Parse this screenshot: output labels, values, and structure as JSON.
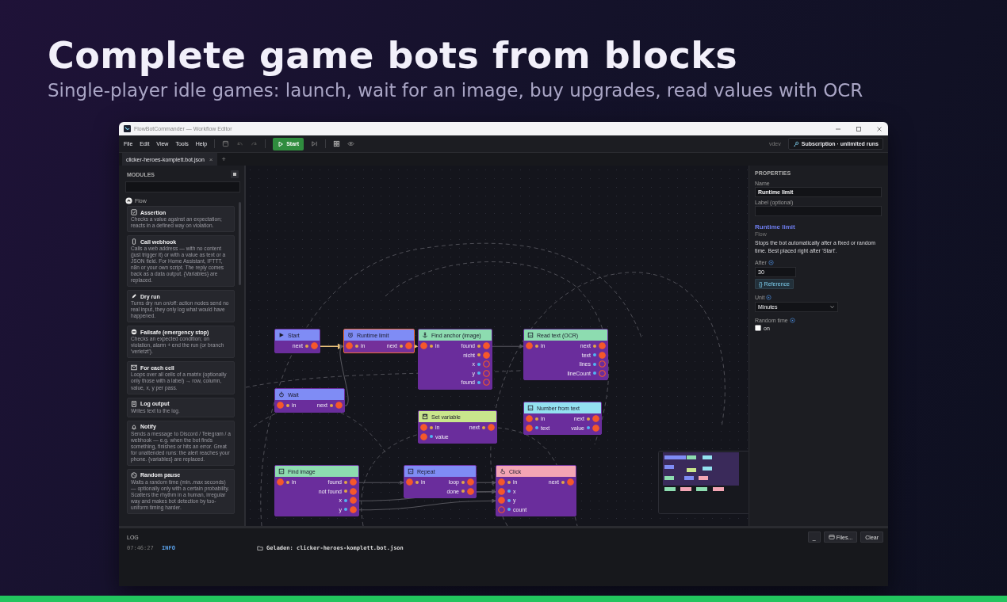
{
  "hero": {
    "title": "Complete game bots from blocks",
    "subtitle": "Single-player idle games: launch, wait for an image, buy upgrades, read values with OCR"
  },
  "window": {
    "title": "FlowBotCommander — Workflow Editor"
  },
  "menu": [
    "File",
    "Edit",
    "View",
    "Tools",
    "Help"
  ],
  "toolbar": {
    "start_label": "Start",
    "version": "vdev",
    "subscription": "Subscription · unlimited runs"
  },
  "tabs": [
    {
      "label": "clicker-heroes-komplett.bot.json",
      "selected": true,
      "close": "×"
    }
  ],
  "new_tab": "+",
  "sidebar": {
    "title": "MODULES",
    "section": {
      "label": "Flow",
      "expanded": true
    },
    "modules": [
      {
        "title": "Assertion",
        "description": "Checks a value against an expectation; reacts in a defined way on violation."
      },
      {
        "title": "Call webhook",
        "description": "Calls a web address — with no content (just trigger it) or with a value as text or a JSON field. For Home Assistant, IFTTT, n8n or your own script. The reply comes back as a data output. {Variables} are replaced."
      },
      {
        "title": "Dry run",
        "description": "Turns dry run on/off: action nodes send no real input, they only log what would have happened."
      },
      {
        "title": "Failsafe (emergency stop)",
        "description": "Checks an expected condition; on violation, alarm + end the run (or branch 'verletzt')."
      },
      {
        "title": "For each cell",
        "description": "Loops over all cells of a matrix (optionally only those with a label) → row, column, value, x, y per pass."
      },
      {
        "title": "Log output",
        "description": "Writes text to the log."
      },
      {
        "title": "Notify",
        "description": "Sends a message to Discord / Telegram / a webhook — e.g. when the bot finds something, finishes or hits an error. Great for unattended runs: the alert reaches your phone. {variables} are replaced."
      },
      {
        "title": "Random pause",
        "description": "Waits a random time (min..max seconds) — optionally only with a certain probability. Scatters the rhythm in a human, irregular way and makes bot detection by too-uniform timing harder."
      }
    ]
  },
  "nodes": [
    {
      "title": "Start",
      "color": "#7f8cf5",
      "selected": false,
      "rows": [
        {
          "output": {
            "label": "next",
            "color": "#e2a646",
            "connected": true
          }
        }
      ]
    },
    {
      "title": "Runtime limit",
      "color": "#7f8cf5",
      "selected": true,
      "rows": [
        {
          "input": {
            "label": "in",
            "color": "#e2a646",
            "connected": true
          },
          "output": {
            "label": "next",
            "color": "#e2a646",
            "connected": true
          }
        }
      ]
    },
    {
      "title": "Find anchor (image)",
      "color": "#8ddcb0",
      "selected": false,
      "rows": [
        {
          "input": {
            "label": "in",
            "color": "#e2a646",
            "connected": true
          },
          "output": {
            "label": "found",
            "color": "#e2a646",
            "connected": true
          }
        },
        {
          "output": {
            "label": "nicht",
            "color": "#e2a646",
            "connected": true
          }
        },
        {
          "output": {
            "label": "x",
            "color": "#52b4f2",
            "connected": false
          }
        },
        {
          "output": {
            "label": "y",
            "color": "#52b4f2",
            "connected": false
          }
        },
        {
          "output": {
            "label": "found",
            "color": "#52b4f2",
            "connected": false
          }
        }
      ]
    },
    {
      "title": "Read text (OCR)",
      "color": "#8ddcb0",
      "selected": false,
      "rows": [
        {
          "input": {
            "label": "in",
            "color": "#e2a646",
            "connected": true
          },
          "output": {
            "label": "next",
            "color": "#e2a646",
            "connected": true
          }
        },
        {
          "output": {
            "label": "text",
            "color": "#52b4f2",
            "connected": true
          }
        },
        {
          "output": {
            "label": "lines",
            "color": "#52b4f2",
            "connected": false
          }
        },
        {
          "output": {
            "label": "lineCount",
            "color": "#52b4f2",
            "connected": false
          }
        }
      ]
    },
    {
      "title": "Wait",
      "color": "#7f8cf5",
      "selected": false,
      "rows": [
        {
          "input": {
            "label": "in",
            "color": "#e2a646",
            "connected": true
          },
          "output": {
            "label": "next",
            "color": "#e2a646",
            "connected": true
          }
        }
      ]
    },
    {
      "title": "Set variable",
      "color": "#c9e68c",
      "selected": false,
      "rows": [
        {
          "input": {
            "label": "in",
            "color": "#e2a646",
            "connected": true
          },
          "output": {
            "label": "next",
            "color": "#e2a646",
            "connected": true
          }
        },
        {
          "input": {
            "label": "value",
            "color": "#52b4f2",
            "connected": true
          }
        }
      ]
    },
    {
      "title": "Number from text",
      "color": "#93e1f0",
      "selected": false,
      "rows": [
        {
          "input": {
            "label": "in",
            "color": "#e2a646",
            "connected": true
          },
          "output": {
            "label": "next",
            "color": "#e2a646",
            "connected": true
          }
        },
        {
          "input": {
            "label": "text",
            "color": "#52b4f2",
            "connected": true
          },
          "output": {
            "label": "value",
            "color": "#52b4f2",
            "connected": true
          }
        }
      ]
    },
    {
      "title": "Find image",
      "color": "#8ddcb0",
      "selected": false,
      "rows": [
        {
          "input": {
            "label": "in",
            "color": "#e2a646",
            "connected": true
          },
          "output": {
            "label": "found",
            "color": "#e2a646",
            "connected": true
          }
        },
        {
          "output": {
            "label": "not found",
            "color": "#e2a646",
            "connected": true
          }
        },
        {
          "output": {
            "label": "x",
            "color": "#52b4f2",
            "connected": true
          }
        },
        {
          "output": {
            "label": "y",
            "color": "#52b4f2",
            "connected": true
          }
        }
      ]
    },
    {
      "title": "Repeat",
      "color": "#7f8cf5",
      "selected": false,
      "rows": [
        {
          "input": {
            "label": "in",
            "color": "#e2a646",
            "connected": true
          },
          "output": {
            "label": "loop",
            "color": "#e2a646",
            "connected": true
          }
        },
        {
          "output": {
            "label": "done",
            "color": "#e2a646",
            "connected": true
          }
        }
      ]
    },
    {
      "title": "Click",
      "color": "#f3a5b4",
      "selected": false,
      "rows": [
        {
          "input": {
            "label": "in",
            "color": "#e2a646",
            "connected": true
          },
          "output": {
            "label": "next",
            "color": "#e2a646",
            "connected": true
          }
        },
        {
          "input": {
            "label": "x",
            "color": "#52b4f2",
            "connected": true
          }
        },
        {
          "input": {
            "label": "y",
            "color": "#52b4f2",
            "connected": true
          }
        },
        {
          "input": {
            "label": "count",
            "color": "#52b4f2",
            "connected": false
          }
        }
      ]
    }
  ],
  "properties": {
    "title": "PROPERTIES",
    "name_label": "Name",
    "name_value": "Runtime limit",
    "label_label": "Label (optional)",
    "node_title": "Runtime limit",
    "category": "Flow",
    "description": "Stops the bot automatically after a fixed or random time. Best placed right after 'Start'.",
    "after_label": "After",
    "after_value": "30",
    "reference_label": "{} Reference",
    "unit_label": "Unit",
    "unit_value": "Minutes",
    "random_label": "Random time",
    "random_option": {
      "label": "on",
      "checked": false
    }
  },
  "log": {
    "title": "LOG",
    "buttons": [
      "_",
      "Files...",
      "Clear"
    ],
    "entries": [
      {
        "time": "07:46:27",
        "level": "INFO",
        "message": "Geladen: clicker-heroes-komplett.bot.json"
      }
    ]
  }
}
